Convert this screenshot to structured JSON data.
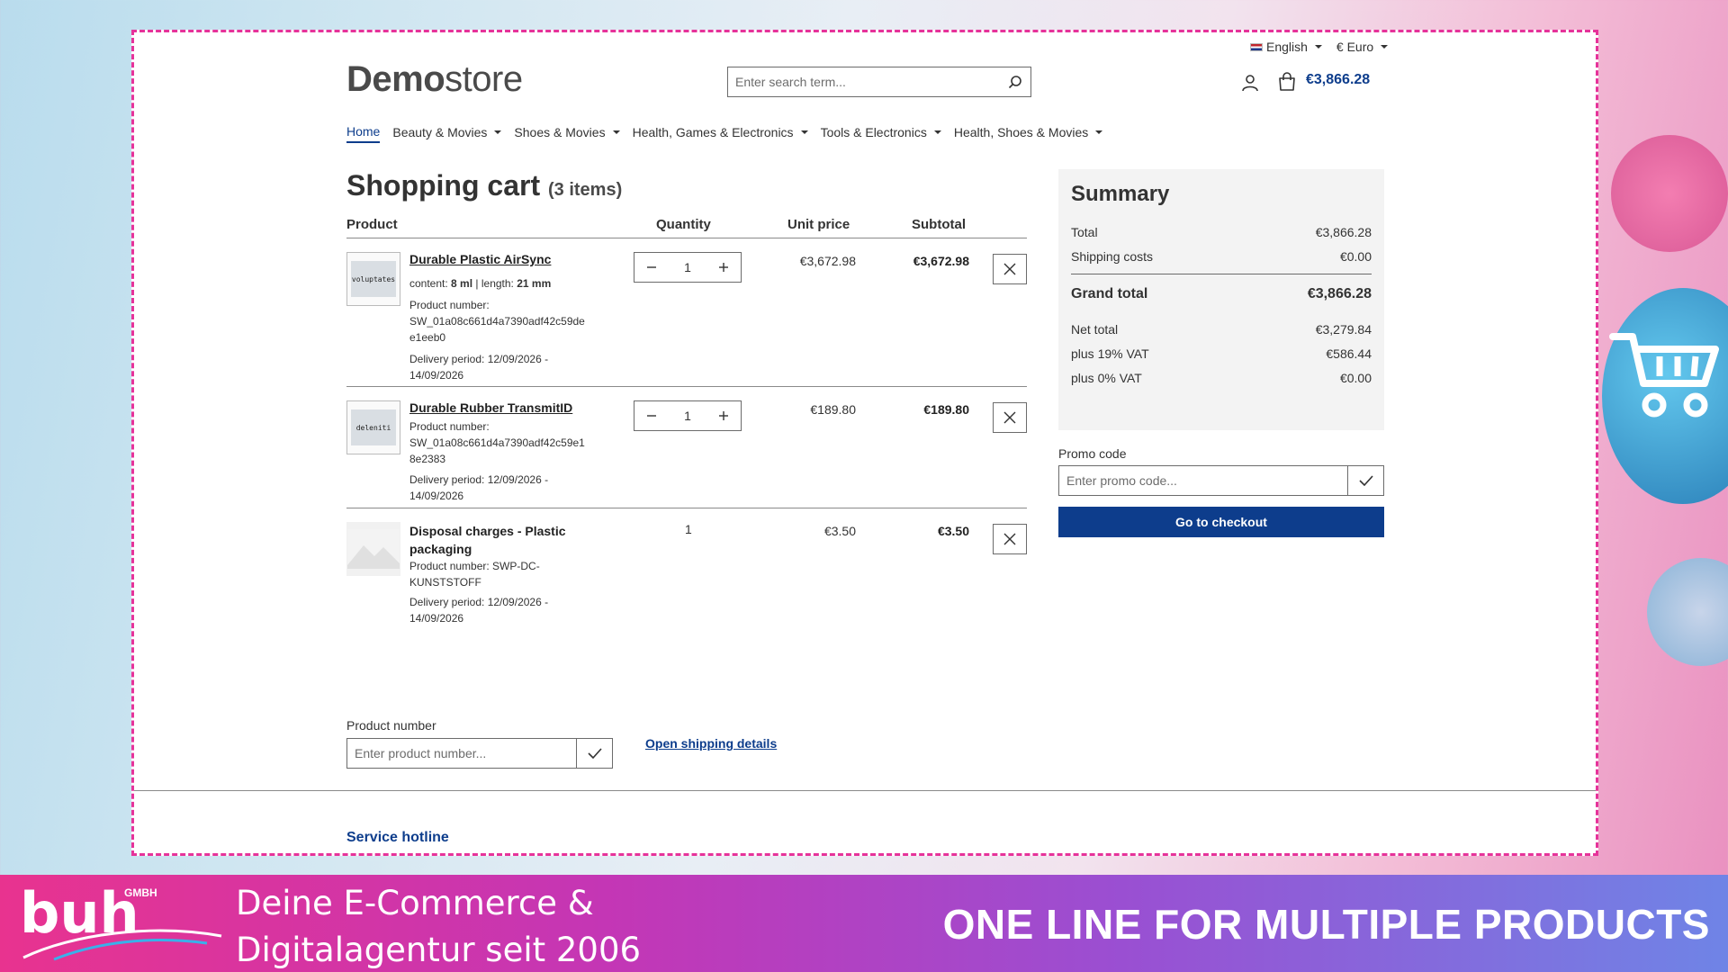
{
  "topbar": {
    "language": "English",
    "currency": "€ Euro"
  },
  "header": {
    "logo_bold": "Demo",
    "logo_light": "store",
    "search_placeholder": "Enter search term...",
    "cart_total": "€3,866.28"
  },
  "nav": {
    "items": [
      {
        "label": "Home"
      },
      {
        "label": "Beauty & Movies"
      },
      {
        "label": "Shoes & Movies"
      },
      {
        "label": "Health, Games & Electronics"
      },
      {
        "label": "Tools & Electronics"
      },
      {
        "label": "Health, Shoes & Movies"
      }
    ]
  },
  "cart": {
    "title": "Shopping cart",
    "count": "(3 items)",
    "columns": {
      "product": "Product",
      "quantity": "Quantity",
      "unit_price": "Unit price",
      "subtotal": "Subtotal"
    },
    "items": [
      {
        "thumb_text": "voluptates",
        "name": "Durable Plastic AirSync",
        "content_label": "content:",
        "content_value": "8 ml",
        "length_label": "length:",
        "length_value": "21 mm",
        "product_number_label": "Product number:",
        "product_number_1": "SW_01a08c661d4a7390adf42c59de",
        "product_number_2": "e1eeb0",
        "delivery_1": "Delivery period: 12/09/2026 -",
        "delivery_2": "14/09/2026",
        "quantity": "1",
        "unit_price": "€3,672.98",
        "subtotal": "€3,672.98"
      },
      {
        "thumb_text": "deleniti",
        "name": "Durable Rubber TransmitID",
        "product_number_label": "Product number:",
        "product_number_1": "SW_01a08c661d4a7390adf42c59e1",
        "product_number_2": "8e2383",
        "delivery_1": "Delivery period: 12/09/2026 -",
        "delivery_2": "14/09/2026",
        "quantity": "1",
        "unit_price": "€189.80",
        "subtotal": "€189.80"
      },
      {
        "name_1": "Disposal charges - Plastic",
        "name_2": "packaging",
        "product_number_1": "Product number: SWP-DC-",
        "product_number_2": "KUNSTSTOFF",
        "delivery_1": "Delivery period: 12/09/2026 -",
        "delivery_2": "14/09/2026",
        "quantity": "1",
        "unit_price": "€3.50",
        "subtotal": "€3.50"
      }
    ],
    "product_number_label": "Product number",
    "product_number_placeholder": "Enter product number...",
    "shipping_link": "Open shipping details"
  },
  "summary": {
    "title": "Summary",
    "total_label": "Total",
    "total": "€3,866.28",
    "shipping_label": "Shipping costs",
    "shipping": "€0.00",
    "grand_label": "Grand total",
    "grand": "€3,866.28",
    "net_label": "Net total",
    "net": "€3,279.84",
    "vat19_label": "plus 19% VAT",
    "vat19": "€586.44",
    "vat0_label": "plus 0% VAT",
    "vat0": "€0.00",
    "promo_label": "Promo code",
    "promo_placeholder": "Enter promo code...",
    "checkout": "Go to checkout"
  },
  "footer": {
    "hotline": "Service hotline"
  },
  "banner": {
    "brand_mark": "buh",
    "brand_suffix": "GMBH",
    "tagline_1": "Deine E-Commerce &",
    "tagline_2": "Digitalagentur seit 2006",
    "slogan": "ONE LINE FOR MULTIPLE PRODUCTS"
  },
  "colors": {
    "accent": "#0d3d8c",
    "frame": "#e6339a"
  }
}
